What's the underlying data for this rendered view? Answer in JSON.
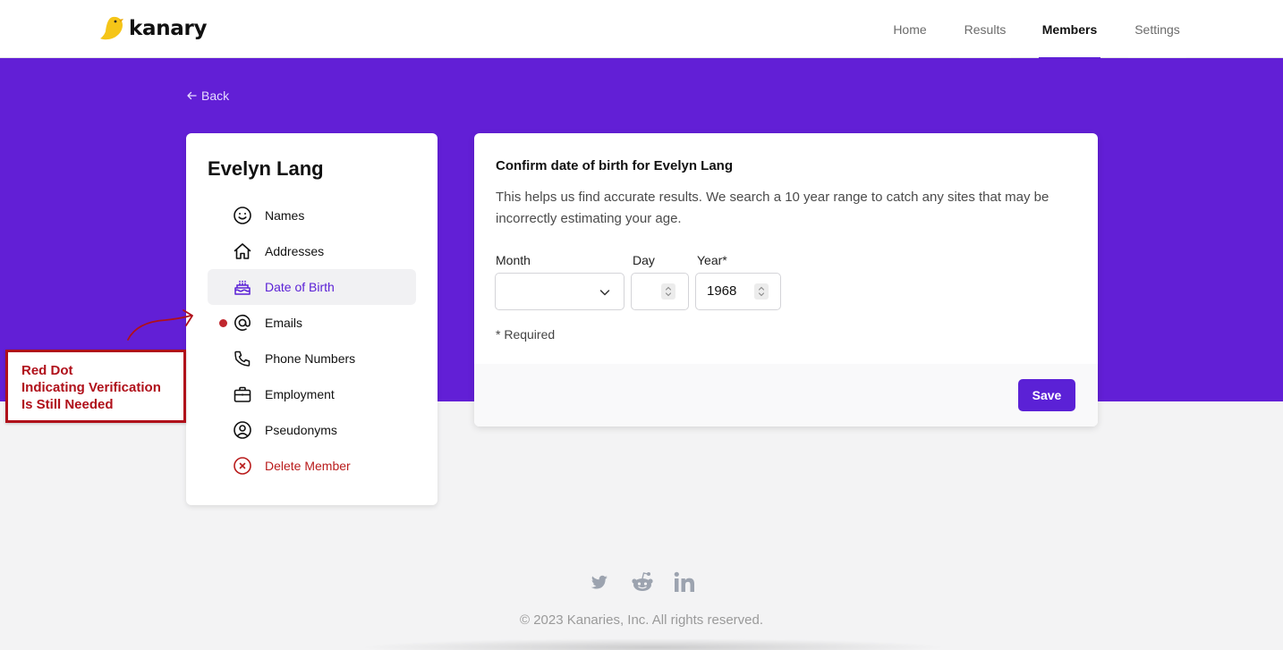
{
  "app": {
    "logo_text": "kanary"
  },
  "nav": {
    "items": [
      {
        "label": "Home",
        "active": false
      },
      {
        "label": "Results",
        "active": false
      },
      {
        "label": "Members",
        "active": true
      },
      {
        "label": "Settings",
        "active": false
      }
    ]
  },
  "back_label": "Back",
  "member": {
    "name": "Evelyn Lang",
    "menu": [
      {
        "label": "Names",
        "icon": "smile-icon"
      },
      {
        "label": "Addresses",
        "icon": "home-icon"
      },
      {
        "label": "Date of Birth",
        "icon": "cake-icon",
        "active": true
      },
      {
        "label": "Emails",
        "icon": "at-sign-icon",
        "needs_verification": true
      },
      {
        "label": "Phone Numbers",
        "icon": "phone-icon"
      },
      {
        "label": "Employment",
        "icon": "briefcase-icon"
      },
      {
        "label": "Pseudonyms",
        "icon": "user-circle-icon"
      },
      {
        "label": "Delete Member",
        "icon": "x-circle-icon",
        "danger": true
      }
    ]
  },
  "form": {
    "title": "Confirm date of birth for Evelyn Lang",
    "description": "This helps us find accurate results. We search a 10 year range to catch any sites that may be incorrectly estimating your age.",
    "month_label": "Month",
    "month_value": "",
    "day_label": "Day",
    "day_value": "",
    "year_label": "Year*",
    "year_value": "1968",
    "required_note": "* Required",
    "save_label": "Save"
  },
  "annotation": {
    "text": "Red Dot\nIndicating Verification\nIs Still Needed"
  },
  "footer": {
    "social": [
      "twitter-icon",
      "reddit-icon",
      "linkedin-icon"
    ],
    "copyright": "© 2023 Kanaries, Inc. All rights reserved."
  },
  "colors": {
    "brand_purple": "#621fd6",
    "accent_purple": "#5b21d6",
    "danger_red": "#b91c1c",
    "annotation_red": "#b0101a",
    "logo_yellow": "#f5c518"
  }
}
